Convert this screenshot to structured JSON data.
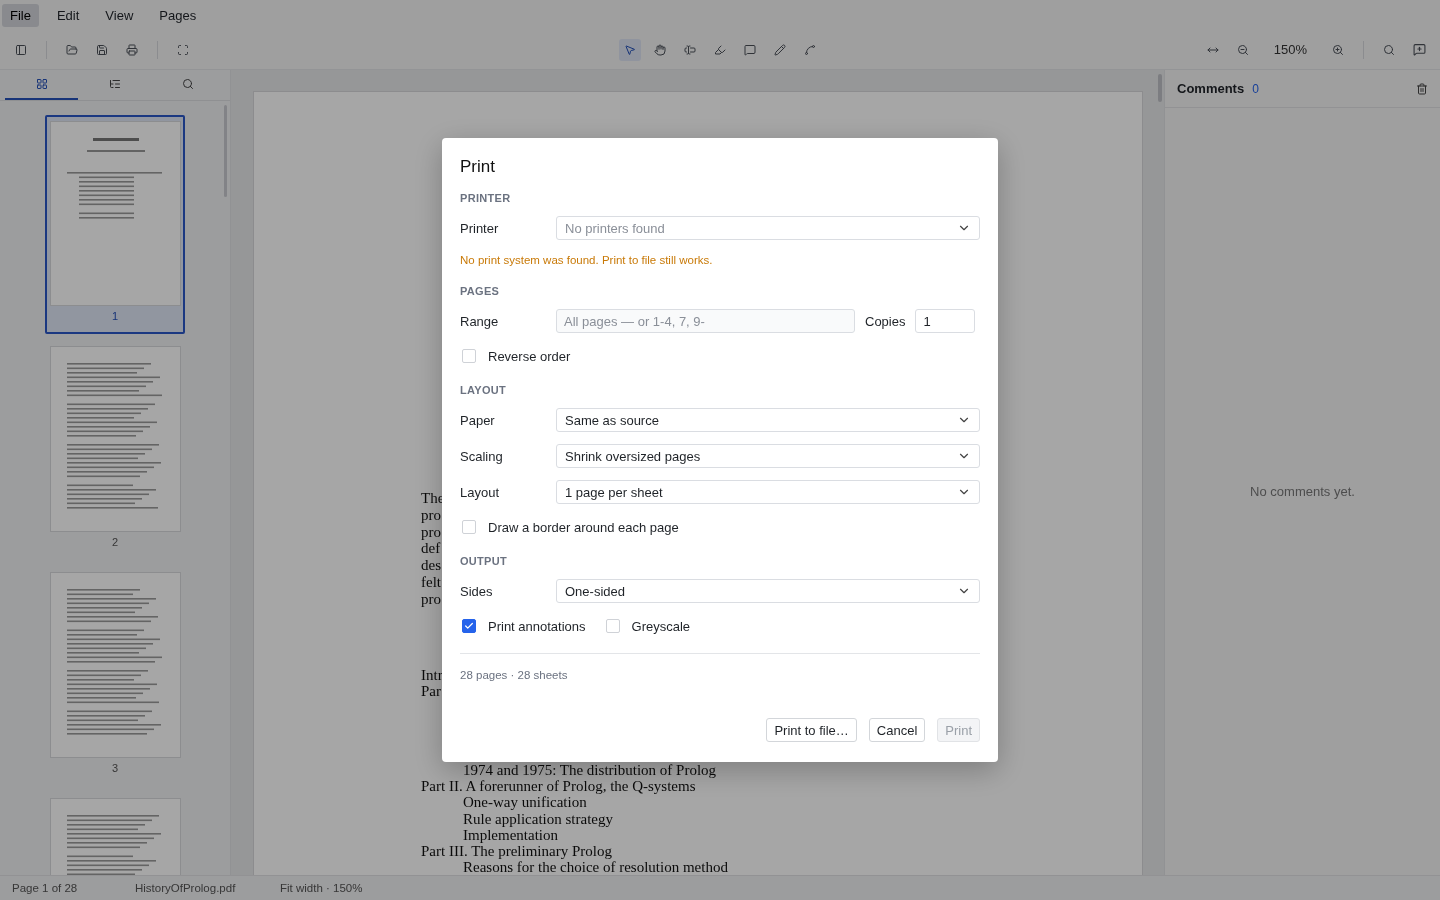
{
  "menu": [
    {
      "label": "File",
      "selected": true
    },
    {
      "label": "Edit",
      "selected": false
    },
    {
      "label": "View",
      "selected": false
    },
    {
      "label": "Pages",
      "selected": false
    }
  ],
  "toolbar": {
    "file_tools": [
      {
        "selected": false
      },
      {
        "selected": false
      },
      {
        "selected": false
      },
      {
        "selected": false
      },
      {
        "selected": false
      }
    ],
    "annotation_tools": [
      {
        "selected": true
      },
      {
        "selected": false
      },
      {
        "selected": false
      },
      {
        "selected": false
      },
      {
        "selected": false
      },
      {
        "selected": false
      },
      {
        "selected": false
      }
    ],
    "zoom": "150%"
  },
  "sidebar": {
    "tabs": [
      {
        "selected": true
      },
      {
        "selected": false
      },
      {
        "selected": false
      }
    ],
    "thumbnails": [
      {
        "page": "1",
        "selected": true
      },
      {
        "page": "2",
        "selected": false
      },
      {
        "page": "3",
        "selected": false
      },
      {
        "selected": false
      }
    ]
  },
  "document": {
    "paragraph_fragments": [
      "The",
      "pro",
      "pro",
      "def",
      "des",
      "felt",
      "pro"
    ],
    "contents_fragments": [
      "Intr",
      "Par"
    ],
    "contents": [
      {
        "children": [
          {
            "text": "1974 and 1975: The distribution of Prolog"
          }
        ]
      },
      {
        "text": "Part II. A forerunner of Prolog, the Q-systems",
        "children": [
          {
            "text": "One-way unification"
          },
          {
            "text": "Rule application strategy"
          },
          {
            "text": "Implementation"
          }
        ]
      },
      {
        "text": "Part III. The preliminary Prolog",
        "children": [
          {
            "text": "Reasons for the choice of resolution method"
          }
        ]
      }
    ]
  },
  "comments": {
    "title": "Comments",
    "count": "0",
    "empty_message": "No comments yet."
  },
  "status_bar": {
    "page": "Page 1 of 28",
    "file": "HistoryOfProlog.pdf",
    "zoom": "Fit width · 150%"
  },
  "dialog": {
    "title": "Print",
    "sections": [
      {
        "heading": "PRINTER",
        "rows": [
          {
            "kind": "select",
            "label": "Printer",
            "placeholder": "No printers found"
          },
          {
            "kind": "note",
            "text": "No print system was found. Print to file still works."
          }
        ]
      },
      {
        "heading": "PAGES",
        "rows": [
          {
            "kind": "range",
            "label": "Range",
            "placeholder": "All pages — or 1-4, 7, 9-",
            "copies_label": "Copies",
            "copies_value": "1"
          },
          {
            "kind": "checkboxes",
            "items": [
              {
                "label": "Reverse order",
                "checked": false
              }
            ]
          }
        ]
      },
      {
        "heading": "LAYOUT",
        "rows": [
          {
            "kind": "select",
            "label": "Paper",
            "value": "Same as source"
          },
          {
            "kind": "select",
            "label": "Scaling",
            "value": "Shrink oversized pages"
          },
          {
            "kind": "select",
            "label": "Layout",
            "value": "1 page per sheet"
          },
          {
            "kind": "checkboxes",
            "items": [
              {
                "label": "Draw a border around each page",
                "checked": false
              }
            ]
          }
        ]
      },
      {
        "heading": "OUTPUT",
        "rows": [
          {
            "kind": "select",
            "label": "Sides",
            "value": "One-sided"
          },
          {
            "kind": "checkboxes",
            "items": [
              {
                "label": "Print annotations",
                "checked": true
              },
              {
                "label": "Greyscale",
                "checked": false
              }
            ]
          }
        ]
      }
    ],
    "summary": "28 pages · 28 sheets",
    "buttons": [
      {
        "label": "Print to file…",
        "disabled": false
      },
      {
        "label": "Cancel",
        "disabled": false
      },
      {
        "label": "Print",
        "disabled": true
      }
    ]
  }
}
